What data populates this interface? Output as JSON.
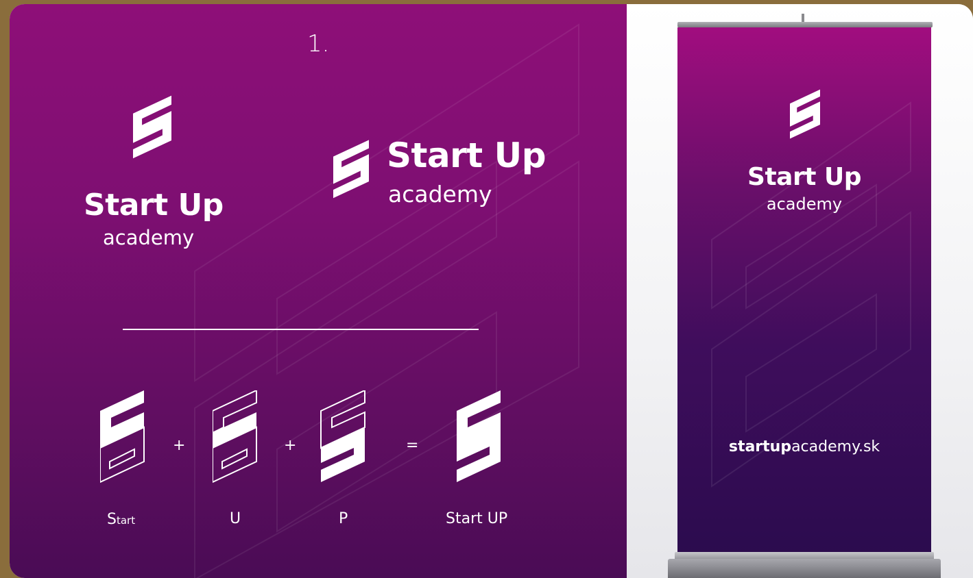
{
  "panel_number": "1.",
  "logo_vertical": {
    "title": "Start Up",
    "subtitle": "academy"
  },
  "logo_horizontal": {
    "title": "Start Up",
    "subtitle": "academy"
  },
  "construction": {
    "items": [
      {
        "label_big": "S",
        "label_small": "tart"
      },
      {
        "label": "U"
      },
      {
        "label": "P"
      },
      {
        "label": "Start UP"
      }
    ],
    "operators": [
      "+",
      "+",
      "="
    ]
  },
  "banner": {
    "title": "Start Up",
    "subtitle": "academy",
    "url_bold": "startup",
    "url_rest": "academy.sk"
  },
  "colors": {
    "brand_magenta": "#8e0f78",
    "brand_deep_purple": "#2a0c4e",
    "white": "#ffffff"
  }
}
